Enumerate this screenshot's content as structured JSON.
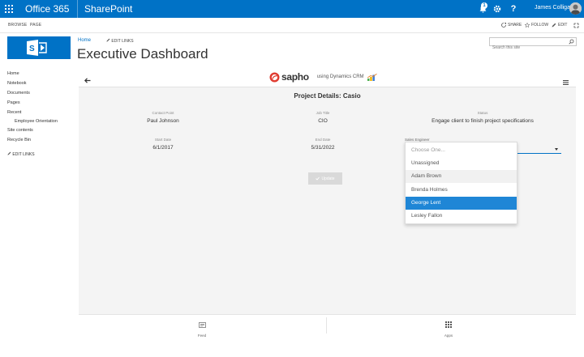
{
  "suite": {
    "app_name": "Office 365",
    "site_name": "SharePoint",
    "notification_count": "1",
    "user_name": "James Colligan"
  },
  "ribbon": {
    "tabs": [
      "BROWSE",
      "PAGE"
    ],
    "share_label": "SHARE",
    "follow_label": "FOLLOW",
    "edit_label": "EDIT"
  },
  "site": {
    "home_link": "Home",
    "edit_links": "EDIT LINKS",
    "page_title": "Executive Dashboard",
    "search_placeholder": "Search this site"
  },
  "leftnav": {
    "items": [
      "Home",
      "Notebook",
      "Documents",
      "Pages",
      "Recent",
      "Employee Orientation",
      "Site contents",
      "Recycle Bin"
    ],
    "edit_links": "EDIT LINKS"
  },
  "app": {
    "brand": "sapho",
    "using_text": "using Dynamics CRM",
    "details_title": "Project Details: Casio",
    "fields": {
      "contact_point_label": "Contact Point",
      "contact_point_value": "Paul Johnson",
      "job_title_label": "Job Title",
      "job_title_value": "CIO",
      "status_label": "Status",
      "status_value": "Engage client to finish project specifications",
      "start_date_label": "Start Date",
      "start_date_value": "6/1/2017",
      "end_date_label": "End Date",
      "end_date_value": "5/31/2022",
      "sales_engineer_label": "Sales Engineer"
    },
    "update_label": "Update",
    "dropdown_options": [
      "Choose One...",
      "Unassigned",
      "Adam Brown",
      "Brenda Holmes",
      "George Lent",
      "Lesley Fallon"
    ],
    "selected_option": "George Lent",
    "bottom": {
      "feed_label": "Feed",
      "apps_label": "Apps"
    }
  },
  "colors": {
    "suite_blue": "#0072c6",
    "selected_blue": "#1f86d6",
    "app_bg": "#f4f4f4"
  }
}
